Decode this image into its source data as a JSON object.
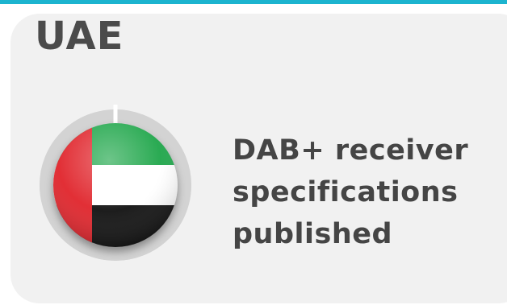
{
  "header": {
    "accent_color": "#1cb4cf"
  },
  "card": {
    "country": "UAE",
    "status_lines": [
      "DAB+ receiver",
      "specifications",
      "published"
    ],
    "progress": 1.0,
    "flag": {
      "name": "uae-flag-icon",
      "colors": {
        "red": "#e0242b",
        "green": "#1fa64a",
        "white": "#ffffff",
        "black": "#111111"
      }
    },
    "ring_color": "#d3d3d3"
  }
}
